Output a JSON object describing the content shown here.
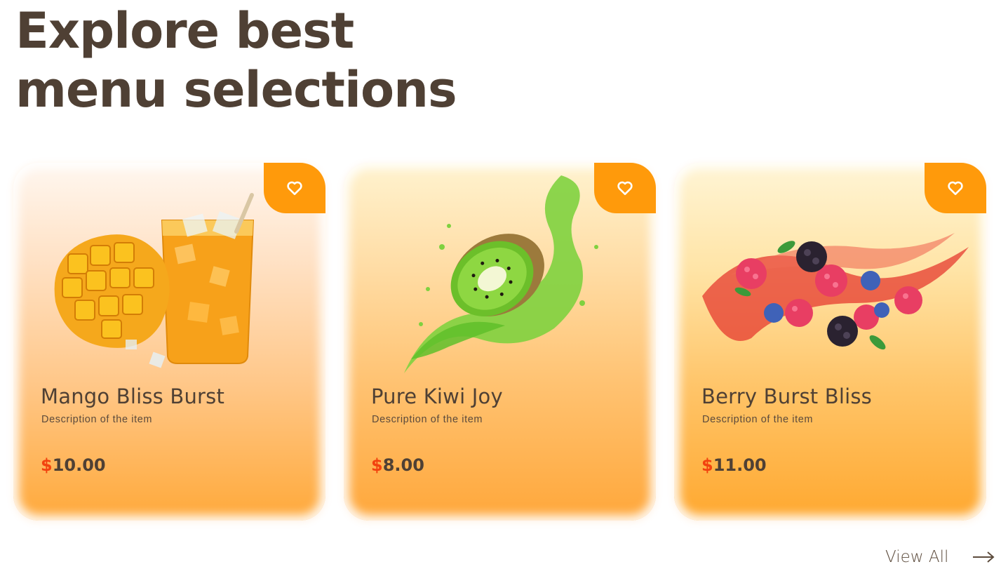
{
  "section": {
    "title_line1": "Explore best",
    "title_line2": "menu selections"
  },
  "cards": [
    {
      "name": "Mango Bliss Burst",
      "description": "Description of the item",
      "currency": "$",
      "price": "10.00",
      "icon": "heart-icon",
      "image": "mango-juice-image"
    },
    {
      "name": "Pure Kiwi Joy",
      "description": "Description of the item",
      "currency": "$",
      "price": "8.00",
      "icon": "heart-icon",
      "image": "kiwi-splash-image"
    },
    {
      "name": "Berry Burst Bliss",
      "description": "Description of the item",
      "currency": "$",
      "price": "11.00",
      "icon": "heart-icon",
      "image": "berry-splash-image"
    }
  ],
  "footer": {
    "view_all_label": "View All",
    "icon": "arrow-right-icon"
  },
  "colors": {
    "heading": "#4f4034",
    "accent": "#ff9a0b",
    "currency": "#f2420f"
  }
}
